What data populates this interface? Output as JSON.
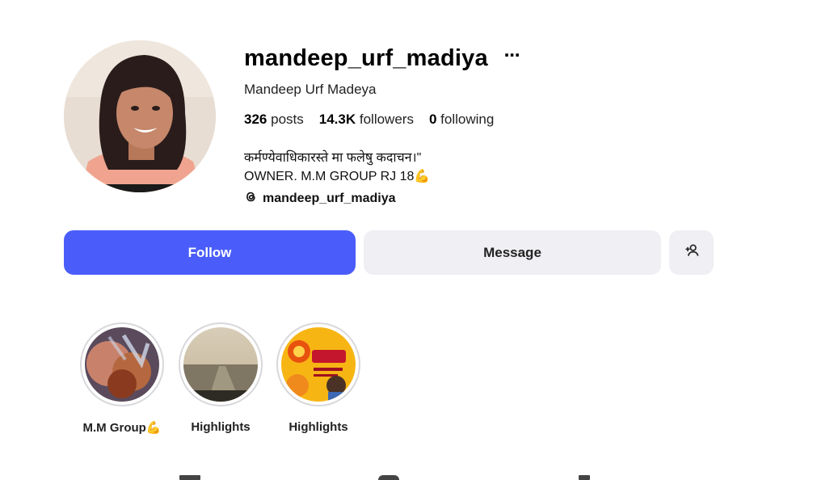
{
  "profile": {
    "username": "mandeep_urf_madiya",
    "full_name": "Mandeep Urf Madeya",
    "stats": {
      "posts_count": "326",
      "posts_label": "posts",
      "followers_count": "14.3K",
      "followers_label": "followers",
      "following_count": "0",
      "following_label": "following"
    },
    "bio_line1": "कर्मण्येवाधिकारस्ते मा फलेषु कदाचन।\"",
    "bio_line2": "OWNER. M.M GROUP RJ 18💪",
    "threads_handle": "mandeep_urf_madiya",
    "more_icon": "⋯"
  },
  "actions": {
    "follow_label": "Follow",
    "message_label": "Message",
    "add_user_icon": "add-user-icon"
  },
  "highlights": [
    {
      "label": "M.M Group💪"
    },
    {
      "label": "Highlights"
    },
    {
      "label": "Highlights"
    }
  ],
  "colors": {
    "follow_button": "#4a5dfa",
    "secondary_button": "#efeff4",
    "ring": "#d8d8dc"
  }
}
